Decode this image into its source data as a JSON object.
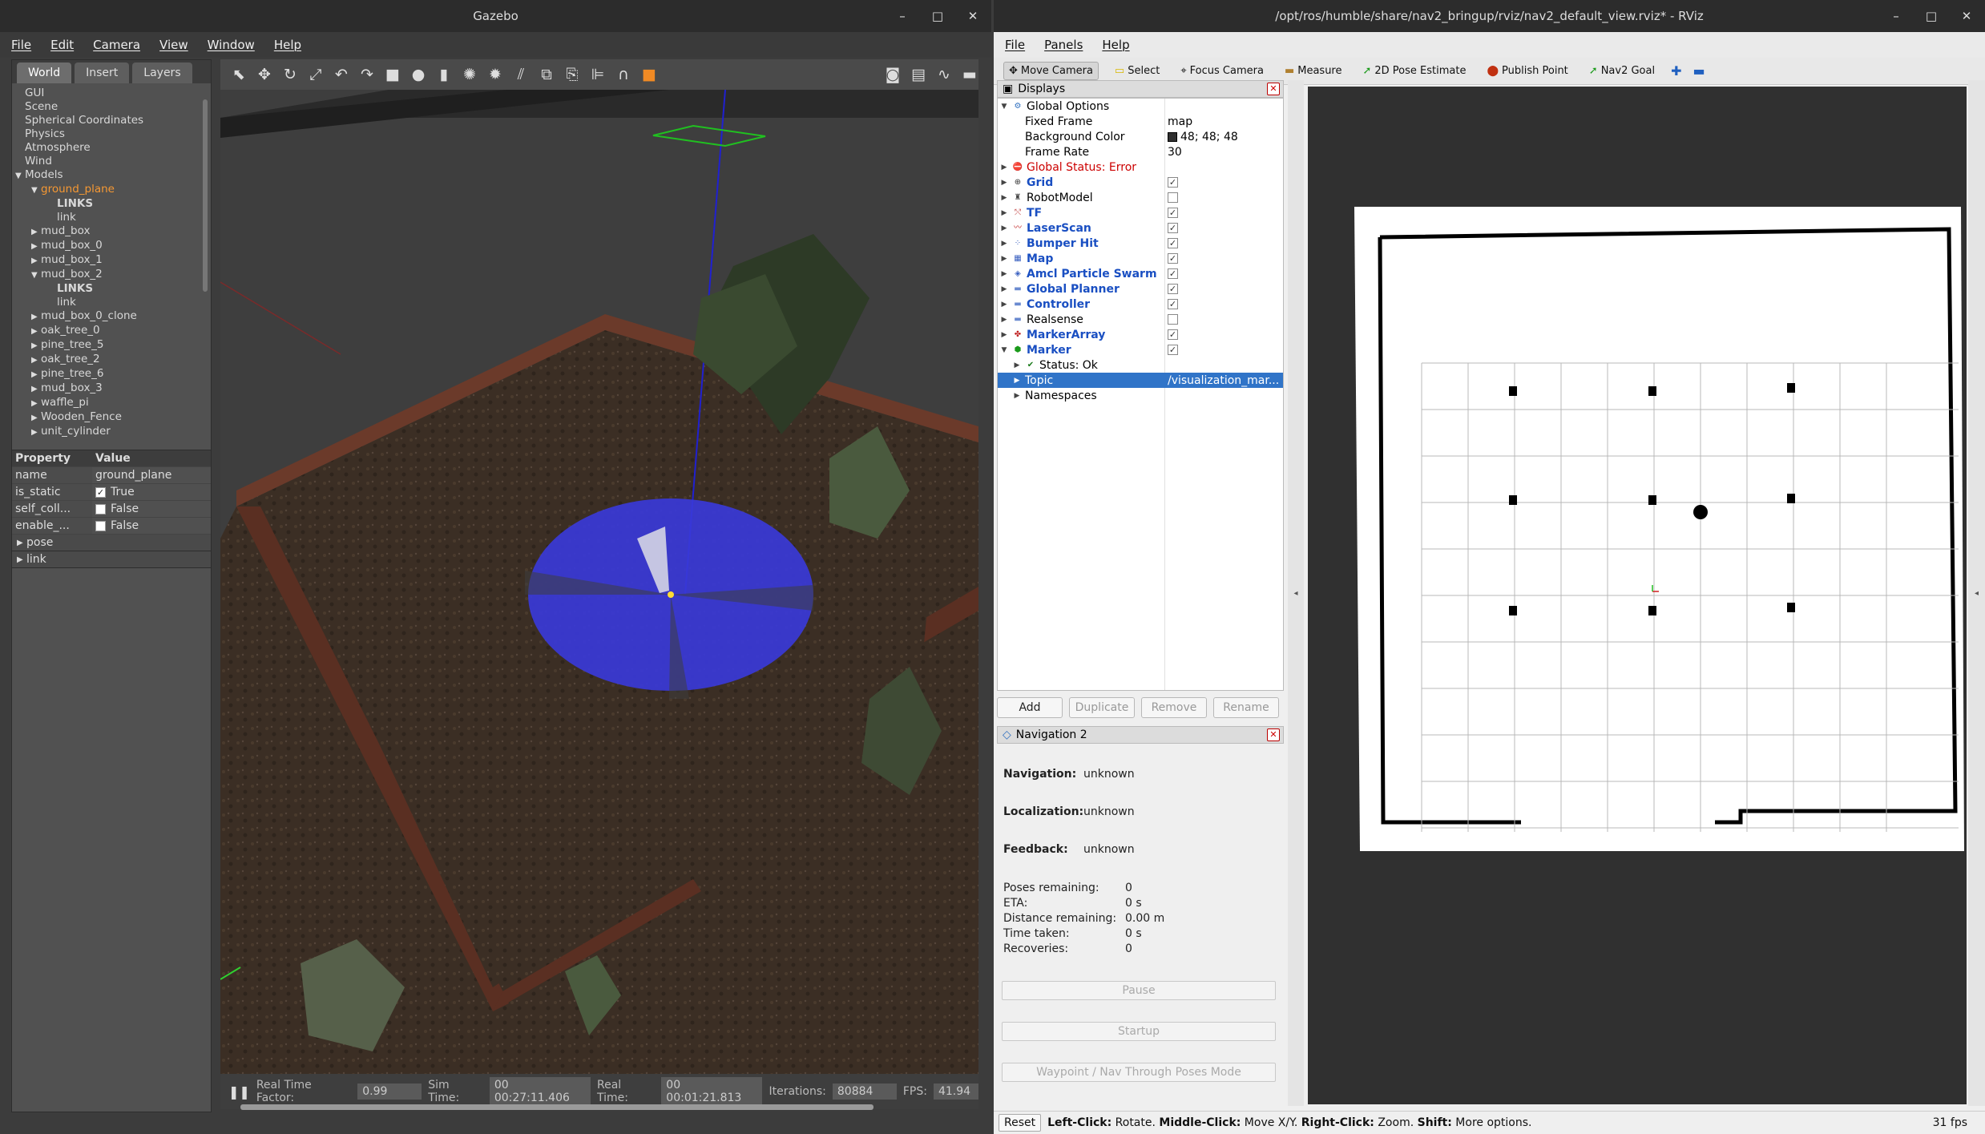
{
  "gazebo": {
    "title": "Gazebo",
    "menu": [
      "File",
      "Edit",
      "Camera",
      "View",
      "Window",
      "Help"
    ],
    "tabs": [
      "World",
      "Insert",
      "Layers"
    ],
    "tree": [
      {
        "label": "GUI",
        "indent": 0,
        "arrow": ""
      },
      {
        "label": "Scene",
        "indent": 0,
        "arrow": ""
      },
      {
        "label": "Spherical Coordinates",
        "indent": 0,
        "arrow": ""
      },
      {
        "label": "Physics",
        "indent": 0,
        "arrow": ""
      },
      {
        "label": "Atmosphere",
        "indent": 0,
        "arrow": ""
      },
      {
        "label": "Wind",
        "indent": 0,
        "arrow": ""
      },
      {
        "label": "Models",
        "indent": 0,
        "arrow": "▼"
      },
      {
        "label": "ground_plane",
        "indent": 1,
        "arrow": "▼",
        "selected": true
      },
      {
        "label": "LINKS",
        "indent": 2,
        "arrow": "",
        "bold": true
      },
      {
        "label": "link",
        "indent": 2,
        "arrow": ""
      },
      {
        "label": "mud_box",
        "indent": 1,
        "arrow": "▶"
      },
      {
        "label": "mud_box_0",
        "indent": 1,
        "arrow": "▶"
      },
      {
        "label": "mud_box_1",
        "indent": 1,
        "arrow": "▶"
      },
      {
        "label": "mud_box_2",
        "indent": 1,
        "arrow": "▼"
      },
      {
        "label": "LINKS",
        "indent": 2,
        "arrow": "",
        "bold": true
      },
      {
        "label": "link",
        "indent": 2,
        "arrow": ""
      },
      {
        "label": "mud_box_0_clone",
        "indent": 1,
        "arrow": "▶"
      },
      {
        "label": "oak_tree_0",
        "indent": 1,
        "arrow": "▶"
      },
      {
        "label": "pine_tree_5",
        "indent": 1,
        "arrow": "▶"
      },
      {
        "label": "oak_tree_2",
        "indent": 1,
        "arrow": "▶"
      },
      {
        "label": "pine_tree_6",
        "indent": 1,
        "arrow": "▶"
      },
      {
        "label": "mud_box_3",
        "indent": 1,
        "arrow": "▶"
      },
      {
        "label": "waffle_pi",
        "indent": 1,
        "arrow": "▶"
      },
      {
        "label": "Wooden_Fence",
        "indent": 1,
        "arrow": "▶"
      },
      {
        "label": "unit_cylinder",
        "indent": 1,
        "arrow": "▶"
      }
    ],
    "props_header": {
      "property": "Property",
      "value": "Value"
    },
    "props": [
      {
        "k": "name",
        "v": "ground_plane",
        "cb": null
      },
      {
        "k": "is_static",
        "v": "True",
        "cb": true
      },
      {
        "k": "self_coll...",
        "v": "False",
        "cb": false
      },
      {
        "k": "enable_...",
        "v": "False",
        "cb": false
      }
    ],
    "prop_groups": [
      "pose",
      "link"
    ],
    "status": {
      "rtf_label": "Real Time Factor:",
      "rtf": "0.99",
      "sim_label": "Sim Time:",
      "sim": "00 00:27:11.406",
      "real_label": "Real Time:",
      "real": "00 00:01:21.813",
      "iter_label": "Iterations:",
      "iter": "80884",
      "fps_label": "FPS:",
      "fps": "41.94"
    }
  },
  "rviz": {
    "title": "/opt/ros/humble/share/nav2_bringup/rviz/nav2_default_view.rviz* - RViz",
    "menu": [
      "File",
      "Panels",
      "Help"
    ],
    "tools": [
      "Move Camera",
      "Select",
      "Focus Camera",
      "Measure",
      "2D Pose Estimate",
      "Publish Point",
      "Nav2 Goal"
    ],
    "displays_title": "Displays",
    "displays": [
      {
        "name": "Global Options",
        "arrow": "▼",
        "icon": "gear",
        "indent": 0
      },
      {
        "name": "Fixed Frame",
        "arrow": "",
        "indent": 1,
        "value": "map"
      },
      {
        "name": "Background Color",
        "arrow": "",
        "indent": 1,
        "value": "48; 48; 48",
        "swatch": "#303030"
      },
      {
        "name": "Frame Rate",
        "arrow": "",
        "indent": 1,
        "value": "30"
      },
      {
        "name": "Global Status: Error",
        "arrow": "▶",
        "icon": "error",
        "indent": 0,
        "cls": "red"
      },
      {
        "name": "Grid",
        "arrow": "▶",
        "icon": "grid",
        "indent": 0,
        "cls": "blue",
        "check": true
      },
      {
        "name": "RobotModel",
        "arrow": "▶",
        "icon": "robot",
        "indent": 0,
        "check": false
      },
      {
        "name": "TF",
        "arrow": "▶",
        "icon": "tf",
        "indent": 0,
        "cls": "blue",
        "check": true
      },
      {
        "name": "LaserScan",
        "arrow": "▶",
        "icon": "laser",
        "indent": 0,
        "cls": "blue",
        "check": true
      },
      {
        "name": "Bumper Hit",
        "arrow": "▶",
        "icon": "dots",
        "indent": 0,
        "cls": "blue",
        "check": true
      },
      {
        "name": "Map",
        "arrow": "▶",
        "icon": "map",
        "indent": 0,
        "cls": "blue",
        "check": true
      },
      {
        "name": "Amcl Particle Swarm",
        "arrow": "▶",
        "icon": "swarm",
        "indent": 0,
        "cls": "blue",
        "check": true
      },
      {
        "name": "Global Planner",
        "arrow": "▶",
        "icon": "folder",
        "indent": 0,
        "cls": "blue",
        "check": true
      },
      {
        "name": "Controller",
        "arrow": "▶",
        "icon": "folder",
        "indent": 0,
        "cls": "blue",
        "check": true
      },
      {
        "name": "Realsense",
        "arrow": "▶",
        "icon": "folder",
        "indent": 0,
        "check": false
      },
      {
        "name": "MarkerArray",
        "arrow": "▶",
        "icon": "markers",
        "indent": 0,
        "cls": "blue",
        "check": true
      },
      {
        "name": "Marker",
        "arrow": "▼",
        "icon": "marker",
        "indent": 0,
        "cls": "blue",
        "check": true
      },
      {
        "name": "Status: Ok",
        "arrow": "▶",
        "icon": "ok",
        "indent": 1
      },
      {
        "name": "Topic",
        "arrow": "▶",
        "indent": 1,
        "value": "/visualization_mar...",
        "selected": true
      },
      {
        "name": "Namespaces",
        "arrow": "▶",
        "indent": 1
      }
    ],
    "buttons": [
      "Add",
      "Duplicate",
      "Remove",
      "Rename"
    ],
    "nav_title": "Navigation 2",
    "nav": {
      "navigation_label": "Navigation:",
      "navigation": "unknown",
      "localization_label": "Localization:",
      "localization": "unknown",
      "feedback_label": "Feedback:",
      "feedback": "unknown",
      "poses_label": "Poses remaining:",
      "poses": "0",
      "eta_label": "ETA:",
      "eta": "0 s",
      "dist_label": "Distance remaining:",
      "dist": "0.00 m",
      "time_label": "Time taken:",
      "time": "0 s",
      "recov_label": "Recoveries:",
      "recov": "0",
      "pause": "Pause",
      "startup": "Startup",
      "waypoint": "Waypoint / Nav Through Poses Mode"
    },
    "status": {
      "reset": "Reset",
      "hint_b1": "Left-Click:",
      "hint_1": " Rotate. ",
      "hint_b2": "Middle-Click:",
      "hint_2": " Move X/Y. ",
      "hint_b3": "Right-Click:",
      "hint_3": " Zoom. ",
      "hint_b4": "Shift:",
      "hint_4": " More options.",
      "fps": "31 fps"
    }
  },
  "colors": {
    "gazebo_bg": "#3c3c3c",
    "laser": "#3a3ad8",
    "fence": "#5a2f22",
    "selected": "#3074c8",
    "error": "#cc0000",
    "link_blue": "#1a4fc2"
  }
}
